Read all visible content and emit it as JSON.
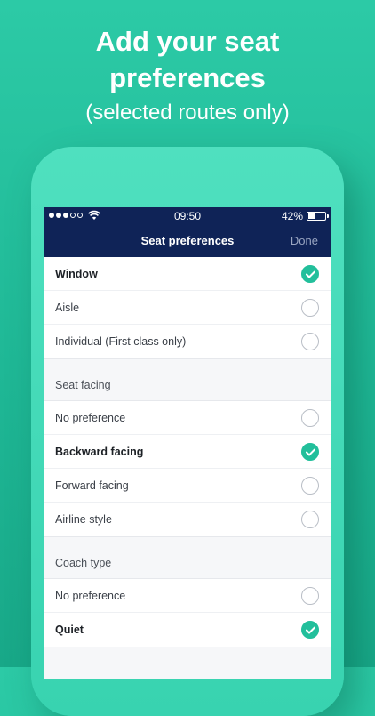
{
  "headline": {
    "line1": "Add your seat",
    "line2": "preferences",
    "subtitle": "(selected routes only)"
  },
  "status_bar": {
    "time": "09:50",
    "battery": "42%"
  },
  "nav": {
    "title": "Seat preferences",
    "done": "Done"
  },
  "sections": [
    {
      "title": "",
      "items": [
        {
          "label": "Window",
          "checked": true
        },
        {
          "label": "Aisle",
          "checked": false
        },
        {
          "label": "Individual (First class only)",
          "checked": false
        }
      ]
    },
    {
      "title": "Seat facing",
      "items": [
        {
          "label": "No preference",
          "checked": false
        },
        {
          "label": "Backward facing",
          "checked": true
        },
        {
          "label": "Forward facing",
          "checked": false
        },
        {
          "label": "Airline style",
          "checked": false
        }
      ]
    },
    {
      "title": "Coach type",
      "items": [
        {
          "label": "No preference",
          "checked": false
        },
        {
          "label": "Quiet",
          "checked": true
        }
      ]
    }
  ],
  "colors": {
    "accent": "#22bf9b",
    "navbar": "#0f2357",
    "background": "#2ccaa6"
  }
}
